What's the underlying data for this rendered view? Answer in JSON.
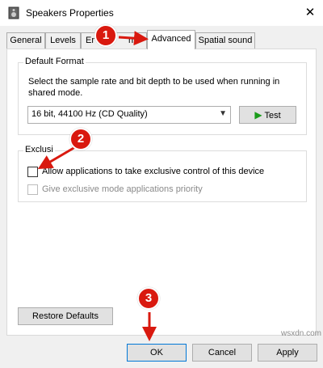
{
  "window": {
    "title": "Speakers Properties",
    "close_glyph": "✕"
  },
  "tabs": [
    {
      "label": "General",
      "active": false
    },
    {
      "label": "Levels",
      "active": false
    },
    {
      "label": "Enhancements",
      "visible_fragments": [
        "Er",
        "nts"
      ],
      "active": false
    },
    {
      "label": "Advanced",
      "active": true
    },
    {
      "label": "Spatial sound",
      "active": false
    }
  ],
  "default_format": {
    "legend": "Default Format",
    "description": "Select the sample rate and bit depth to be used when running in shared mode.",
    "selected_format": "16 bit, 44100 Hz (CD Quality)",
    "dropdown_glyph": "▼",
    "test_label": "Test",
    "test_glyph": "▶"
  },
  "exclusive_mode": {
    "legend": "Exclusive Mode",
    "visible_legend_fragment": "Exclusi",
    "options": [
      {
        "label": "Allow applications to take exclusive control of this device",
        "checked": false,
        "enabled": true
      },
      {
        "label": "Give exclusive mode applications priority",
        "checked": false,
        "enabled": false
      }
    ]
  },
  "buttons": {
    "restore_defaults": "Restore Defaults",
    "ok": "OK",
    "cancel": "Cancel",
    "apply": "Apply"
  },
  "annotations": [
    "1",
    "2",
    "3"
  ],
  "watermark": "wsxdn.com",
  "colors": {
    "badge": "#d9190f",
    "arrow": "#d9190f",
    "accent": "#0078d7",
    "test_play": "#1a9c1a"
  }
}
